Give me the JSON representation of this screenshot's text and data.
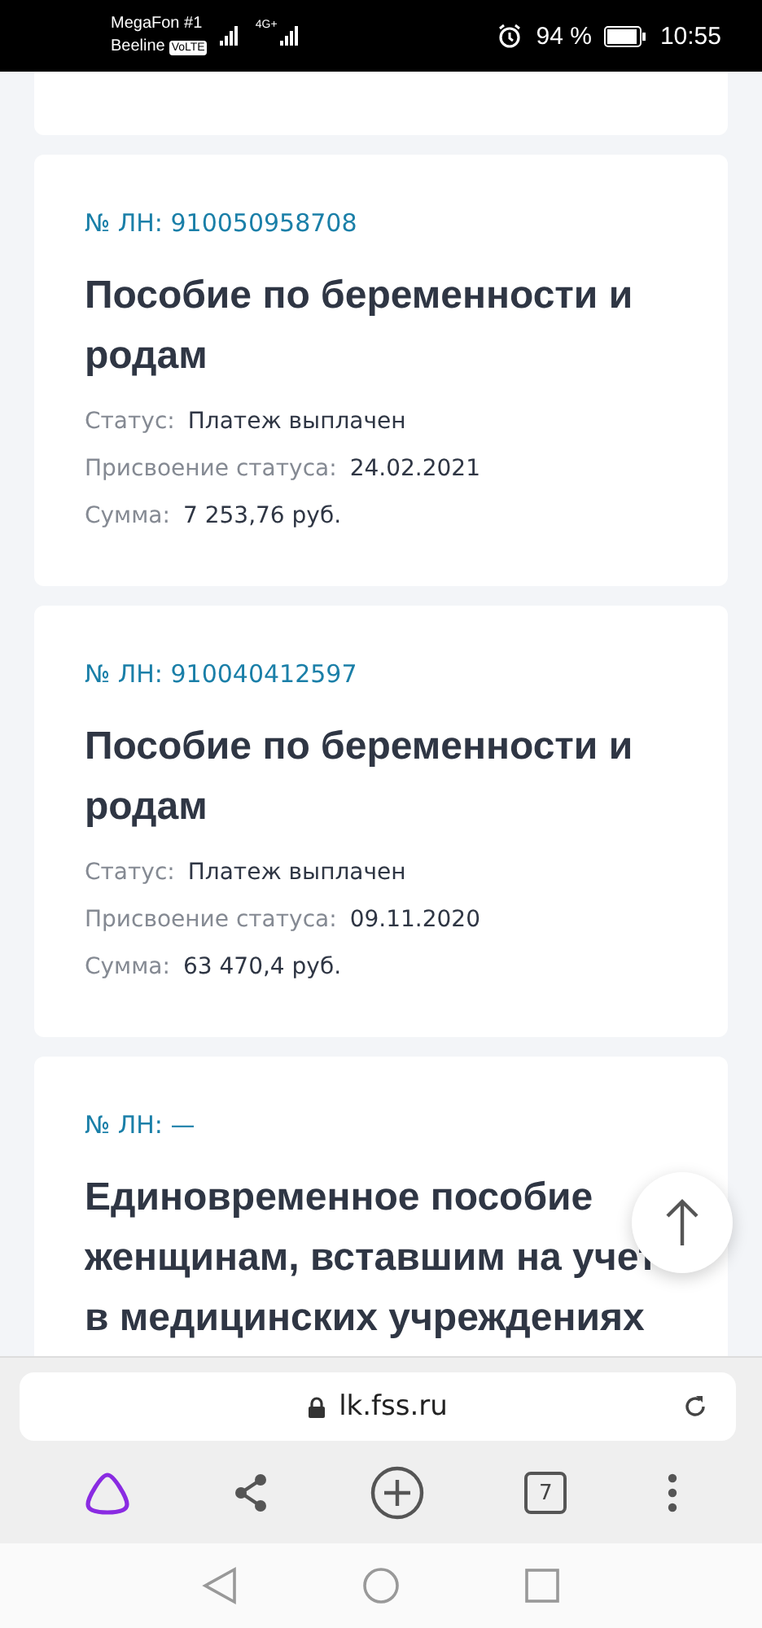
{
  "status_bar": {
    "carrier_1": "MegaFon #1",
    "carrier_2": "Beeline",
    "volte": "VoLTE",
    "network": "4G+",
    "battery": "94 %",
    "time": "10:55"
  },
  "cards": [
    {
      "number": "№ ЛН: 910050958708",
      "title": "Пособие по беременности и родам",
      "fields": [
        {
          "label": "Статус:",
          "value": "Платеж выплачен"
        },
        {
          "label": "Присвоение статуса:",
          "value": "24.02.2021"
        },
        {
          "label": "Сумма:",
          "value": "7 253,76 руб."
        }
      ]
    },
    {
      "number": "№ ЛН: 910040412597",
      "title": "Пособие по беременности и родам",
      "fields": [
        {
          "label": "Статус:",
          "value": "Платеж выплачен"
        },
        {
          "label": "Присвоение статуса:",
          "value": "09.11.2020"
        },
        {
          "label": "Сумма:",
          "value": "63 470,4 руб."
        }
      ]
    },
    {
      "number": "№ ЛН: —",
      "title": "Единовременное пособие женщинам, вставшим на учет в медицинских учреждениях"
    }
  ],
  "browser": {
    "url": "lk.fss.ru",
    "tab_count": "7"
  }
}
